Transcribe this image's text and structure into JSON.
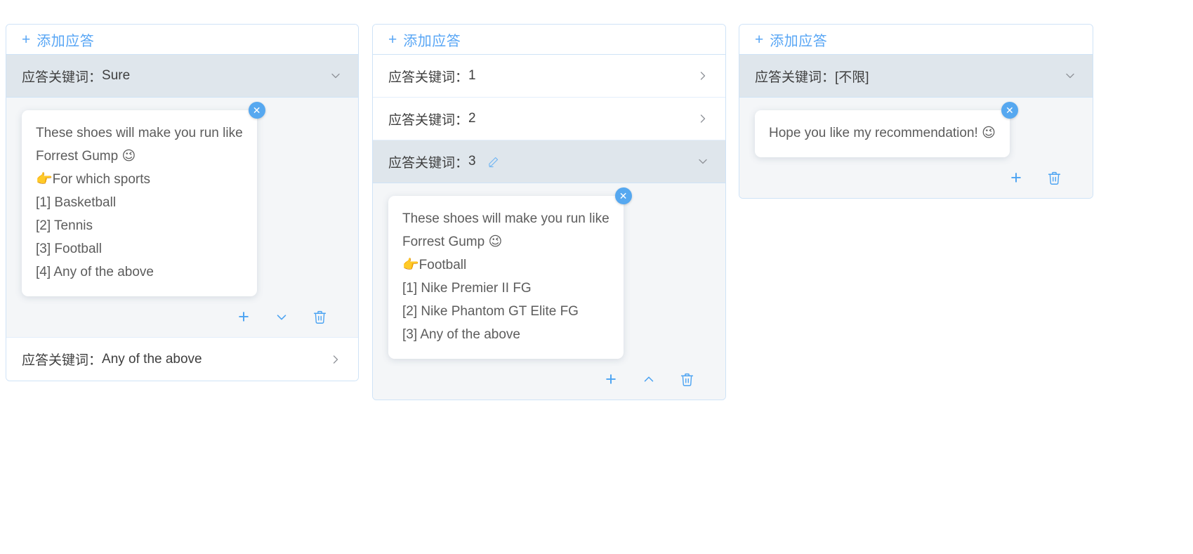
{
  "page": {
    "background": "#ffffff",
    "accent_color": "#58a6f5",
    "active_row_background": "#dfe6ec",
    "body_background": "#f4f6f8",
    "text_color": "#5c5c5c"
  },
  "cards": [
    {
      "header": {
        "plus": "+",
        "label": "添加应答"
      },
      "rows": [
        {
          "label": "应答关键词：",
          "value": "Sure",
          "state": "expanded",
          "caret": "chevron-down",
          "has_edit_icon": false,
          "bubble": {
            "lines": [
              "These shoes will make you run like",
              "Forrest Gump 😉",
              "👉For which sports",
              "[1] Basketball",
              "[2] Tennis",
              "[3] Football",
              "[4] Any of the above"
            ],
            "close_label": "✕"
          },
          "actions": [
            {
              "icon": "plus-icon",
              "glyph": "+"
            },
            {
              "icon": "chevron-down-icon",
              "glyph": "⌄"
            },
            {
              "icon": "trash-icon",
              "glyph": "🗑"
            }
          ]
        },
        {
          "label": "应答关键词：",
          "value": "Any of the above",
          "state": "collapsed",
          "caret": "chevron-right",
          "has_edit_icon": false
        }
      ]
    },
    {
      "header": {
        "plus": "+",
        "label": "添加应答"
      },
      "rows": [
        {
          "label": "应答关键词：",
          "value": "1",
          "state": "collapsed",
          "caret": "chevron-right",
          "has_edit_icon": false
        },
        {
          "label": "应答关键词：",
          "value": "2",
          "state": "collapsed",
          "caret": "chevron-right",
          "has_edit_icon": false
        },
        {
          "label": "应答关键词：",
          "value": "3",
          "state": "expanded",
          "caret": "chevron-down",
          "has_edit_icon": true,
          "edit_icon": "pencil-icon",
          "bubble": {
            "lines": [
              "These shoes will make you run like",
              "Forrest Gump 😉",
              "👉Football",
              "[1] Nike Premier II FG",
              "[2] Nike Phantom GT Elite FG",
              "[3] Any of the above"
            ],
            "close_label": "✕"
          },
          "actions": [
            {
              "icon": "plus-icon",
              "glyph": "+"
            },
            {
              "icon": "chevron-up-icon",
              "glyph": "⌃"
            },
            {
              "icon": "trash-icon",
              "glyph": "🗑"
            }
          ]
        }
      ]
    },
    {
      "header": {
        "plus": "+",
        "label": "添加应答"
      },
      "rows": [
        {
          "label": "应答关键词：",
          "value": "[不限]",
          "state": "expanded",
          "caret": "chevron-down",
          "has_edit_icon": false,
          "bubble": {
            "lines": [
              "Hope you like my recommendation! 😉"
            ],
            "close_label": "✕"
          },
          "actions": [
            {
              "icon": "plus-icon",
              "glyph": "+"
            },
            {
              "icon": "trash-icon",
              "glyph": "🗑"
            }
          ]
        }
      ]
    }
  ]
}
